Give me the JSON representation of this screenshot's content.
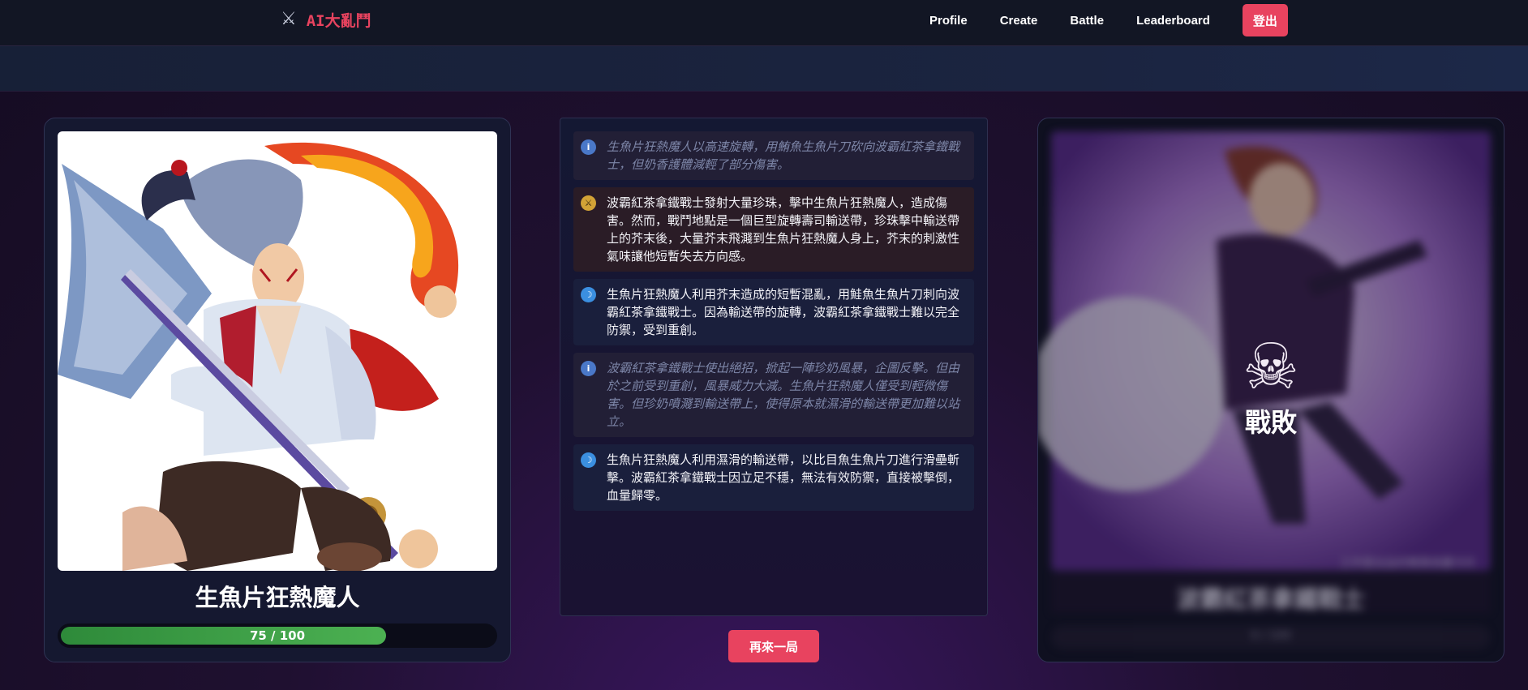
{
  "nav": {
    "brand_icon": "⚔",
    "brand_name": "AI大亂鬥",
    "links": [
      "Profile",
      "Create",
      "Battle",
      "Leaderboard"
    ],
    "logout_label": "登出"
  },
  "player": {
    "name": "生魚片狂熱魔人",
    "hp_current": 75,
    "hp_max": 100,
    "hp_text": "75 / 100"
  },
  "opponent": {
    "name": "波霸紅茶拿鐵戰士",
    "hp_text": "0 / 100",
    "caption": "工作室出品的精美收藏卡片",
    "status_icon": "skull-icon",
    "status_label": "戰敗"
  },
  "battle_log": [
    {
      "type": "info",
      "icon": "info-icon",
      "text": "生魚片狂熱魔人以高速旋轉，用鮪魚生魚片刀砍向波霸紅茶拿鐵戰士，但奶香護體減輕了部分傷害。"
    },
    {
      "type": "attack",
      "icon": "sword-icon",
      "text": "波霸紅茶拿鐵戰士發射大量珍珠，擊中生魚片狂熱魔人，造成傷害。然而，戰鬥地點是一個巨型旋轉壽司輸送帶，珍珠擊中輸送帶上的芥末後，大量芥末飛濺到生魚片狂熱魔人身上，芥末的刺激性氣味讓他短暫失去方向感。"
    },
    {
      "type": "magic",
      "icon": "magic-icon",
      "text": "生魚片狂熱魔人利用芥末造成的短暫混亂，用鮭魚生魚片刀刺向波霸紅茶拿鐵戰士。因為輸送帶的旋轉，波霸紅茶拿鐵戰士難以完全防禦，受到重創。"
    },
    {
      "type": "info",
      "icon": "info-icon",
      "text": "波霸紅茶拿鐵戰士使出絕招，掀起一陣珍奶風暴，企圖反擊。但由於之前受到重創，風暴威力大減。生魚片狂熱魔人僅受到輕微傷害。但珍奶噴濺到輸送帶上，使得原本就濕滑的輸送帶更加難以站立。"
    },
    {
      "type": "magic",
      "icon": "magic-icon",
      "text": "生魚片狂熱魔人利用濕滑的輸送帶，以比目魚生魚片刀進行滑壘斬擊。波霸紅茶拿鐵戰士因立足不穩，無法有效防禦，直接被擊倒，血量歸零。"
    }
  ],
  "rematch_label": "再來一局",
  "colors": {
    "accent": "#e8435f",
    "hp_green": "#4cb152",
    "nav_bg": "#121624"
  }
}
